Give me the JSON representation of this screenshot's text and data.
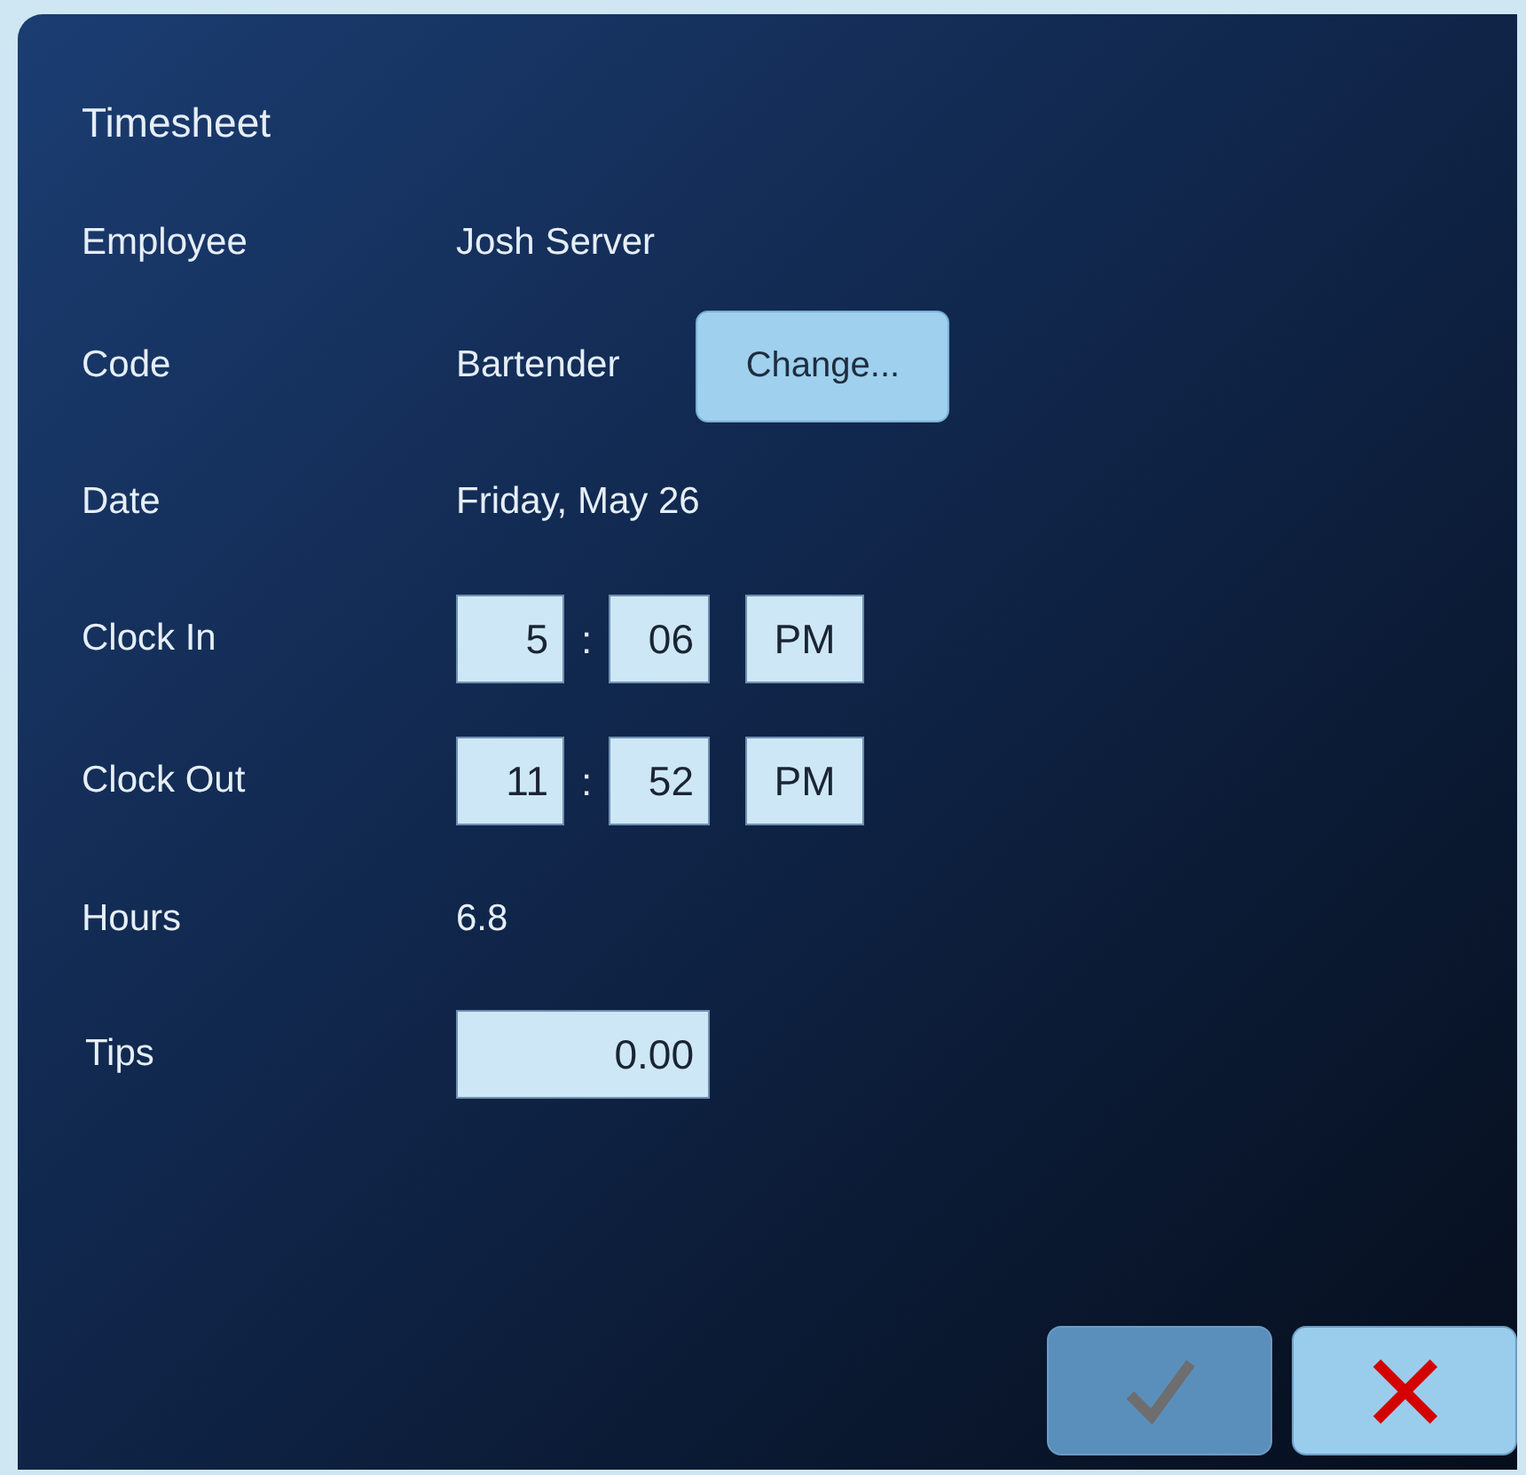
{
  "title": "Timesheet",
  "rows": [
    {
      "kind": "text",
      "label": "Employee",
      "value": "Josh Server"
    },
    {
      "kind": "text_button",
      "label": "Code",
      "value": "Bartender",
      "button": "Change..."
    },
    {
      "kind": "text",
      "label": "Date",
      "value": "Friday, May 26"
    },
    {
      "kind": "time",
      "label": "Clock In",
      "hour": "5",
      "separator": ":",
      "minute": "06",
      "period": "PM"
    },
    {
      "kind": "time",
      "label": "Clock Out",
      "hour": "11",
      "separator": ":",
      "minute": "52",
      "period": "PM"
    },
    {
      "kind": "text",
      "label": "Hours",
      "value": "6.8"
    },
    {
      "kind": "field",
      "label": "Tips",
      "value": "0.00"
    }
  ],
  "actions": [
    {
      "kind": "confirm",
      "disabled": true
    },
    {
      "kind": "cancel",
      "disabled": false
    }
  ]
}
